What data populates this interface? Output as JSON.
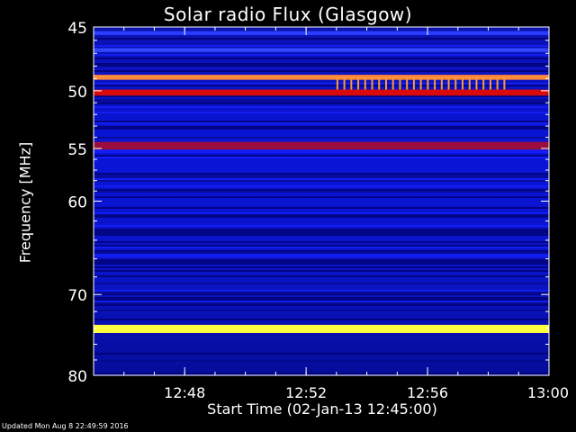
{
  "title": "Solar radio Flux (Glasgow)",
  "footer": "Updated Mon Aug  8 22:49:59 2016",
  "colors": {
    "background": "#000000",
    "axes": "#ffffff"
  },
  "chart_data": {
    "type": "heatmap",
    "title": "Solar radio Flux (Glasgow)",
    "xlabel": "Start Time (02-Jan-13 12:45:00)",
    "ylabel": "Frequency [MHz]",
    "xlim": [
      "12:45",
      "13:00"
    ],
    "ylim": [
      45,
      80
    ],
    "yscale": "log",
    "yticks": [
      45,
      50,
      55,
      60,
      70,
      80
    ],
    "yticklabels": [
      "45",
      "50",
      "55",
      "60",
      "70",
      "80"
    ],
    "xticks": [
      "12:48",
      "12:52",
      "12:56",
      "13:00"
    ],
    "xticklabels": [
      "12:48",
      "12:52",
      "12:56",
      "13:00"
    ],
    "bands": [
      {
        "f_lo": 45.3,
        "f_hi": 45.6,
        "level": "medium",
        "color": "#2a3cff"
      },
      {
        "f_lo": 46.6,
        "f_hi": 46.9,
        "level": "medium",
        "color": "#3347ff"
      },
      {
        "f_lo": 48.7,
        "f_hi": 49.1,
        "level": "very high",
        "color": "#ff8a3a"
      },
      {
        "f_lo": 49.9,
        "f_hi": 50.4,
        "level": "high",
        "color": "#d80a0a"
      },
      {
        "f_lo": 54.4,
        "f_hi": 55.1,
        "level": "high",
        "color": "#9a0d3c"
      },
      {
        "f_lo": 73.6,
        "f_hi": 74.6,
        "level": "max",
        "color": "#ffff40"
      }
    ],
    "spikes": {
      "f_lo": 48.9,
      "f_hi": 49.9,
      "t_start": "12:53",
      "t_end": "12:58.5",
      "count": 25,
      "color": "#ff9a2a"
    },
    "colorscale": [
      "#000030",
      "#000090",
      "#1a22ff",
      "#b0104e",
      "#ff2a00",
      "#ff9a2a",
      "#ffff40"
    ]
  }
}
